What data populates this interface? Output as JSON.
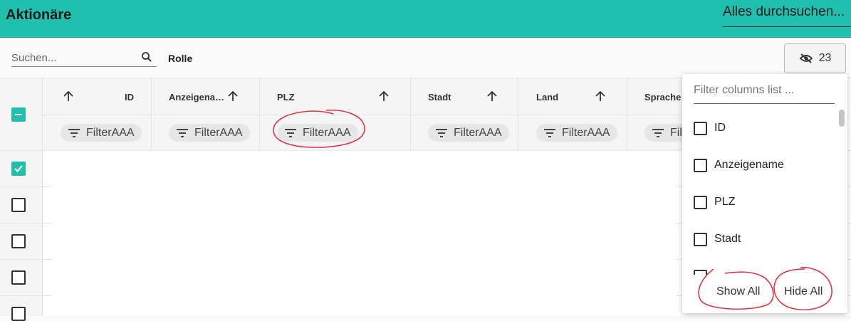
{
  "app": {
    "title": "Aktionäre",
    "global_search": "Alles durchsuchen..."
  },
  "toolbar": {
    "search_placeholder": "Suchen...",
    "role_label": "Rolle",
    "hidden_columns_count": "23",
    "search_icon": "search-icon",
    "hidden_icon": "eye-off-icon"
  },
  "columns": [
    {
      "title": "ID",
      "filter": "FilterAAA"
    },
    {
      "title": "Anzeigena…",
      "filter": "FilterAAA"
    },
    {
      "title": "PLZ",
      "filter": "FilterAAA"
    },
    {
      "title": "Stadt",
      "filter": "FilterAAA"
    },
    {
      "title": "Land",
      "filter": "FilterAAA"
    },
    {
      "title": "Sprache",
      "filter": "Filt"
    }
  ],
  "column_panel": {
    "filter_placeholder": "Filter columns list ...",
    "items": [
      "ID",
      "Anzeigename",
      "PLZ",
      "Stadt"
    ],
    "show_all": "Show All",
    "hide_all": "Hide All"
  },
  "colors": {
    "accent": "#20bfae",
    "annotation": "#e03545"
  }
}
